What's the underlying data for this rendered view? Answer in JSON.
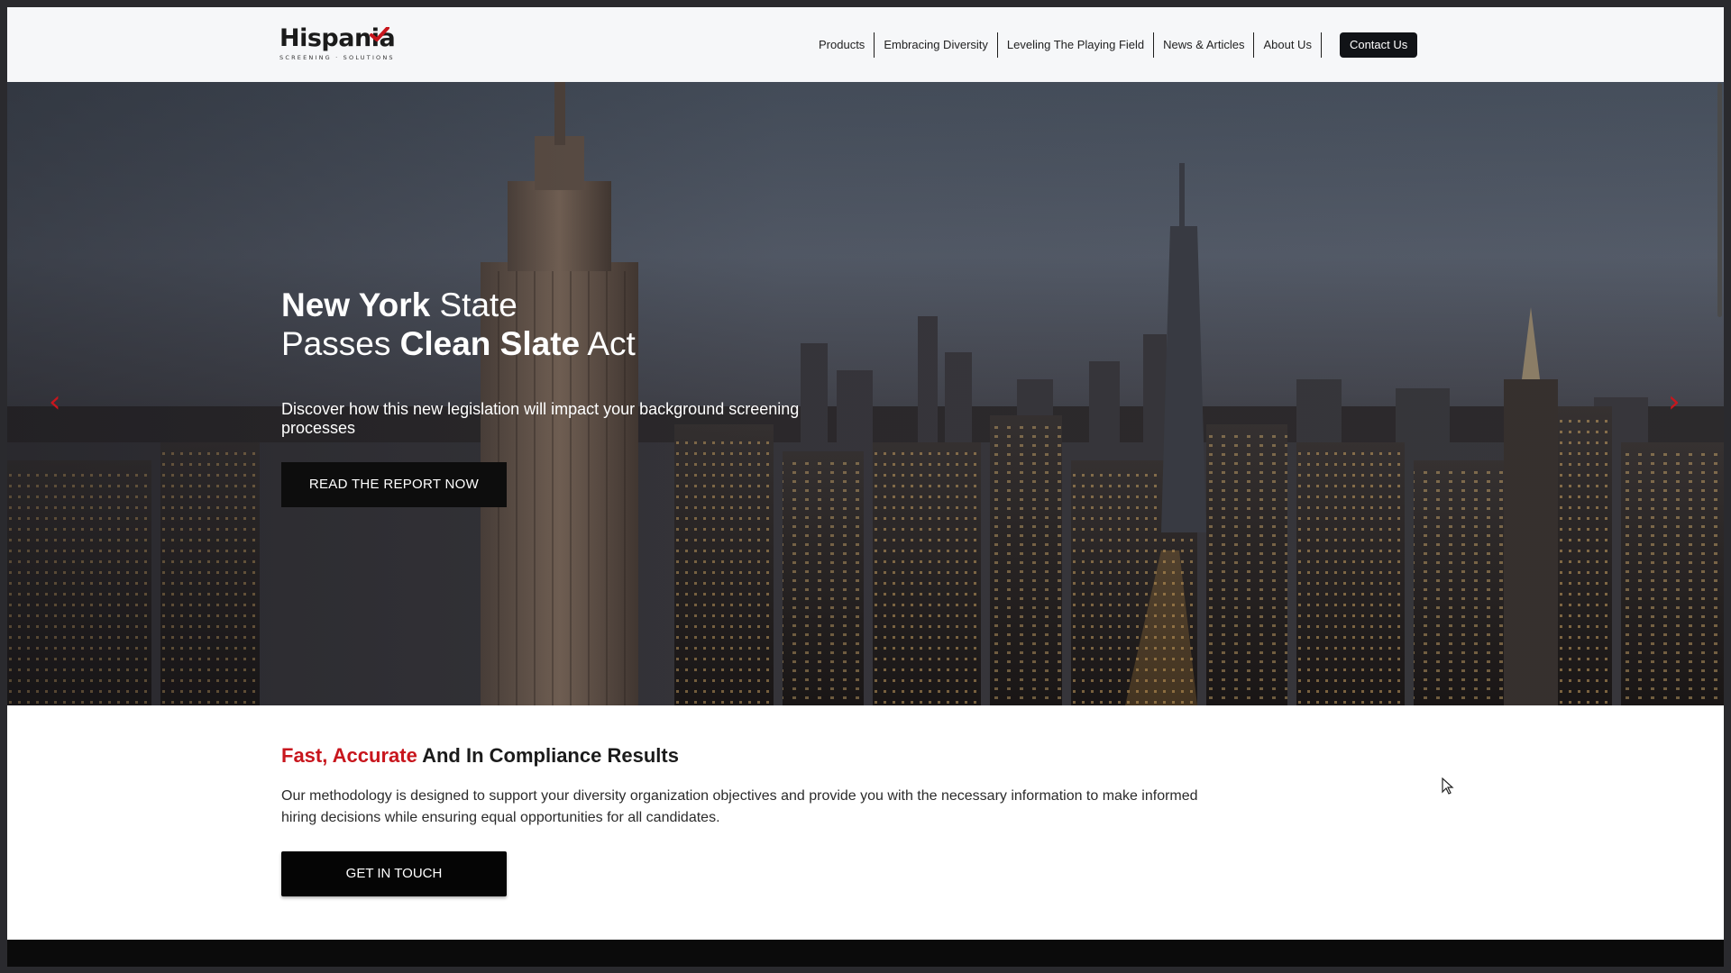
{
  "brand": {
    "logo_text": "Hispania",
    "logo_tagline": "SCREENING · SOLUTIONS",
    "accent_color": "#c8161d"
  },
  "nav": {
    "items": [
      {
        "label": "Products"
      },
      {
        "label": "Embracing Diversity"
      },
      {
        "label": "Leveling The Playing Field"
      },
      {
        "label": "News & Articles"
      },
      {
        "label": "About Us"
      }
    ],
    "contact_label": "Contact Us"
  },
  "hero": {
    "title_bold_1": "New York",
    "title_normal_1": " State",
    "title_normal_2": "Passes ",
    "title_bold_2": "Clean Slate",
    "title_normal_3": " Act",
    "subtitle": "Discover how this new legislation will impact your background screening processes",
    "button_label": "READ THE REPORT NOW",
    "prev_icon": "‹",
    "next_icon": "›"
  },
  "intro": {
    "title_accent": "Fast, Accurate",
    "title_rest": " And In Compliance Results",
    "body": "Our methodology is designed to support your diversity organization objectives and provide you with the necessary information to make informed hiring decisions while ensuring equal opportunities for all candidates.",
    "button_label": "GET IN TOUCH"
  }
}
